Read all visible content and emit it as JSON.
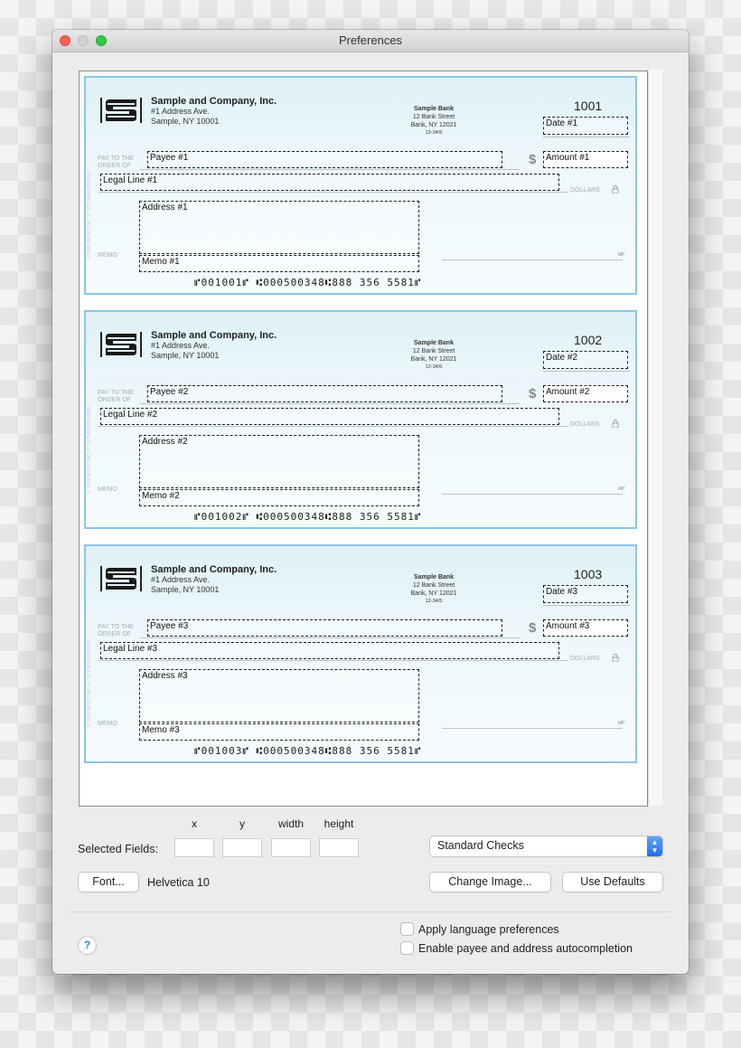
{
  "window": {
    "title": "Preferences"
  },
  "checks": [
    {
      "company_name": "Sample and Company, Inc.",
      "company_address1": "#1 Address Ave.",
      "company_address2": "Sample, NY 10001",
      "bank_name": "Sample Bank",
      "bank_address1": "12 Bank Street",
      "bank_address2": "Bank, NY 12021",
      "routing_fraction": "12-34/5",
      "check_number": "1001",
      "pay_to_label_1": "PAY TO THE",
      "pay_to_label_2": "ORDER OF",
      "dollar_sign": "$",
      "dollars_label": "DOLLARS",
      "memo_label": "MEMO",
      "mp_label": "MP",
      "side_text": "© 2005 INTUIT INC. # 735  1-800-433-8810",
      "fields": {
        "date": "Date #1",
        "payee": "Payee #1",
        "amount": "Amount #1",
        "legal": "Legal Line #1",
        "address": "Address #1",
        "memo": "Memo #1"
      },
      "micr": "⑈001001⑈ ⑆000500348⑆888 356 5581⑈"
    },
    {
      "company_name": "Sample and Company, Inc.",
      "company_address1": "#1 Address Ave.",
      "company_address2": "Sample, NY 10001",
      "bank_name": "Sample Bank",
      "bank_address1": "12 Bank Street",
      "bank_address2": "Bank, NY 12021",
      "routing_fraction": "12-34/5",
      "check_number": "1002",
      "pay_to_label_1": "PAY TO THE",
      "pay_to_label_2": "ORDER OF",
      "dollar_sign": "$",
      "dollars_label": "DOLLARS",
      "memo_label": "MEMO",
      "mp_label": "MP",
      "side_text": "© 2005 INTUIT INC. # 735  1-800-433-8810",
      "fields": {
        "date": "Date #2",
        "payee": "Payee #2",
        "amount": "Amount #2",
        "legal": "Legal Line #2",
        "address": "Address #2",
        "memo": "Memo #2"
      },
      "micr": "⑈001002⑈ ⑆000500348⑆888 356 5581⑈"
    },
    {
      "company_name": "Sample and Company, Inc.",
      "company_address1": "#1 Address Ave.",
      "company_address2": "Sample, NY 10001",
      "bank_name": "Sample Bank",
      "bank_address1": "12 Bank Street",
      "bank_address2": "Bank, NY 12021",
      "routing_fraction": "12-34/5",
      "check_number": "1003",
      "pay_to_label_1": "PAY TO THE",
      "pay_to_label_2": "ORDER OF",
      "dollar_sign": "$",
      "dollars_label": "DOLLARS",
      "memo_label": "MEMO",
      "mp_label": "MP",
      "side_text": "© 2005 INTUIT INC. # 735  1-800-433-8810",
      "fields": {
        "date": "Date #3",
        "payee": "Payee #3",
        "amount": "Amount #3",
        "legal": "Legal Line #3",
        "address": "Address #3",
        "memo": "Memo #3"
      },
      "micr": "⑈001003⑈ ⑆000500348⑆888 356 5581⑈"
    }
  ],
  "selected_fields": {
    "label": "Selected Fields:",
    "columns": [
      "x",
      "y",
      "width",
      "height"
    ],
    "values": [
      "",
      "",
      "",
      ""
    ]
  },
  "check_style": {
    "selected": "Standard Checks",
    "icon": "up-down-chevron-icon"
  },
  "font": {
    "button_label": "Font...",
    "current": "Helvetica 10"
  },
  "buttons": {
    "change_image": "Change Image...",
    "use_defaults": "Use Defaults",
    "help": "?"
  },
  "options": [
    {
      "label": "Apply language preferences",
      "checked": false
    },
    {
      "label": "Enable payee and address autocompletion",
      "checked": false
    }
  ],
  "colors": {
    "accent": "#1c6ef3",
    "check_border": "#8cc5e8",
    "close": "#fc605c",
    "maximize": "#34c84a"
  }
}
